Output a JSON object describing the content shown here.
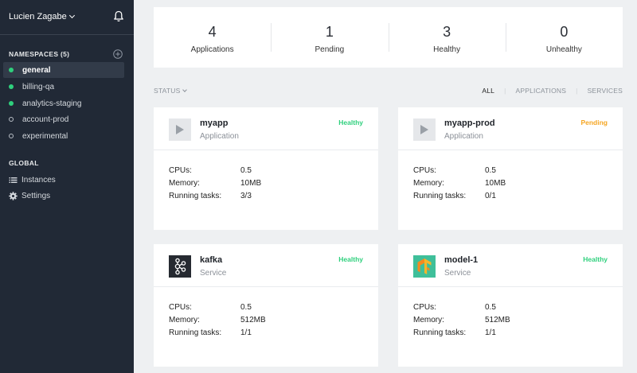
{
  "sidebar": {
    "user_name": "Lucien Zagabe",
    "namespaces_header": "NAMESPACES (5)",
    "namespaces": [
      {
        "label": "general",
        "status": "healthy",
        "active": true
      },
      {
        "label": "billing-qa",
        "status": "healthy",
        "active": false
      },
      {
        "label": "analytics-staging",
        "status": "healthy",
        "active": false
      },
      {
        "label": "account-prod",
        "status": "inactive",
        "active": false
      },
      {
        "label": "experimental",
        "status": "inactive",
        "active": false
      }
    ],
    "global_header": "GLOBAL",
    "global_items": [
      {
        "label": "Instances",
        "icon": "list-icon"
      },
      {
        "label": "Settings",
        "icon": "gear-icon"
      }
    ]
  },
  "summary": [
    {
      "value": "4",
      "label": "Applications"
    },
    {
      "value": "1",
      "label": "Pending"
    },
    {
      "value": "3",
      "label": "Healthy"
    },
    {
      "value": "0",
      "label": "Unhealthy"
    }
  ],
  "toolbar": {
    "status_filter": "STATUS",
    "filters": [
      "ALL",
      "APPLICATIONS",
      "SERVICES"
    ],
    "active_filter": "ALL"
  },
  "labels": {
    "cpus": "CPUs:",
    "memory": "Memory:",
    "running": "Running tasks:"
  },
  "cards": [
    {
      "name": "myapp",
      "type": "Application",
      "status": "Healthy",
      "icon": "play-icon",
      "cpus": "0.5",
      "memory": "10MB",
      "tasks": "3/3"
    },
    {
      "name": "myapp-prod",
      "type": "Application",
      "status": "Pending",
      "icon": "play-icon",
      "cpus": "0.5",
      "memory": "10MB",
      "tasks": "0/1"
    },
    {
      "name": "kafka",
      "type": "Service",
      "status": "Healthy",
      "icon": "kafka-icon",
      "cpus": "0.5",
      "memory": "512MB",
      "tasks": "1/1"
    },
    {
      "name": "model-1",
      "type": "Service",
      "status": "Healthy",
      "icon": "tensorflow-icon",
      "cpus": "0.5",
      "memory": "512MB",
      "tasks": "1/1"
    }
  ],
  "colors": {
    "sidebar_bg": "#212936",
    "healthy": "#2fd07d",
    "pending": "#f5a623"
  }
}
